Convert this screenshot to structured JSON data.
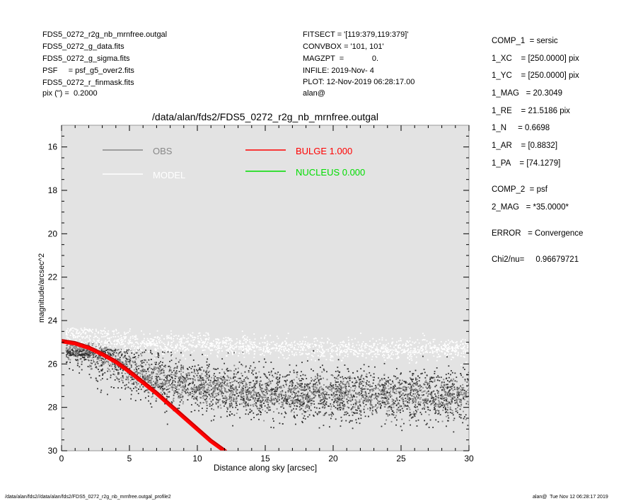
{
  "header": {
    "left": [
      "FDS5_0272_r2g_nb_mrnfree.outgal",
      "FDS5_0272_g_data.fits",
      "FDS5_0272_g_sigma.fits",
      "PSF     = psf_g5_over2.fits",
      "FDS5_0272_r_finmask.fits",
      "pix (\") =  0.2000"
    ],
    "middle": [
      "FITSECT = '[119:379,119:379]'",
      "CONVBOX = '101, 101'",
      "MAGZPT  =             0.",
      "INFILE: 2019-Nov- 4",
      "PLOT: 12-Nov-2019 06:28:17.00",
      "alan@"
    ]
  },
  "params": [
    "COMP_1  = sersic",
    "1_XC    = [250.0000] pix",
    "1_YC    = [250.0000] pix",
    "1_MAG   = 20.3049",
    "1_RE    = 21.5186 pix",
    "1_N     = 0.6698",
    "1_AR    = [0.8832]",
    "1_PA    = [74.1279]",
    "COMP_2  = psf",
    "2_MAG   = *35.0000*",
    "ERROR   = Convergence",
    "Chi2/nu=     0.96679721"
  ],
  "footer": {
    "left": "/data/alan/fds2//data/alan/fds2/FDS5_0272_r2g_nb_mrnfree.outgal_profile2",
    "right": "alan@  Tue Nov 12 06:28:17 2019"
  },
  "colors": {
    "plot_bg": "#e3e3e3",
    "obs": "#888888",
    "model": "#ffffff",
    "bulge": "#ff0000",
    "nucleus": "#00dd00",
    "dark_points": "#333333"
  },
  "chart_data": {
    "type": "scatter",
    "title": "/data/alan/fds2/FDS5_0272_r2g_nb_mrnfree.outgal",
    "xlabel": "Distance along sky [arcsec]",
    "ylabel": "magnitude/arcsec^2",
    "xlim": [
      0,
      30
    ],
    "ylim": [
      30,
      15
    ],
    "y_inverted": true,
    "xticks": [
      0,
      5,
      10,
      15,
      20,
      25,
      30
    ],
    "yticks": [
      16,
      18,
      20,
      22,
      24,
      26,
      28,
      30
    ],
    "grid": false,
    "legend": [
      {
        "label": "OBS",
        "color": "#888888"
      },
      {
        "label": "MODEL",
        "color": "#ffffff"
      },
      {
        "label": "BULGE  1.000",
        "color": "#ff0000"
      },
      {
        "label": "NUCLEUS  0.000",
        "color": "#00dd00"
      }
    ],
    "series": [
      {
        "name": "OBS",
        "type": "scatter",
        "x": [
          0.5,
          1,
          2,
          3,
          4,
          5,
          6,
          8,
          10,
          12,
          15,
          18,
          20,
          22,
          25,
          28,
          30
        ],
        "y": [
          25.0,
          25.0,
          25.4,
          25.6,
          25.9,
          26.2,
          26.5,
          26.8,
          27.0,
          27.2,
          27.3,
          27.4,
          27.4,
          27.4,
          27.5,
          27.5,
          27.5
        ]
      },
      {
        "name": "MODEL",
        "type": "scatter",
        "x": [
          0.5,
          1,
          2,
          5,
          10,
          15,
          20,
          25,
          30
        ],
        "y": [
          24.6,
          24.6,
          24.7,
          25.0,
          25.1,
          25.2,
          25.3,
          25.3,
          25.3
        ]
      },
      {
        "name": "BULGE  1.000",
        "type": "line",
        "x": [
          0,
          1,
          2,
          3,
          4,
          5,
          6,
          7,
          8,
          9,
          10,
          11,
          12,
          12.5
        ],
        "y": [
          24.95,
          25.05,
          25.25,
          25.55,
          25.9,
          26.35,
          26.85,
          27.35,
          27.9,
          28.45,
          29.0,
          29.55,
          30.0,
          30.3
        ]
      },
      {
        "name": "NUCLEUS  0.000",
        "type": "line",
        "x": [],
        "y": []
      }
    ]
  }
}
